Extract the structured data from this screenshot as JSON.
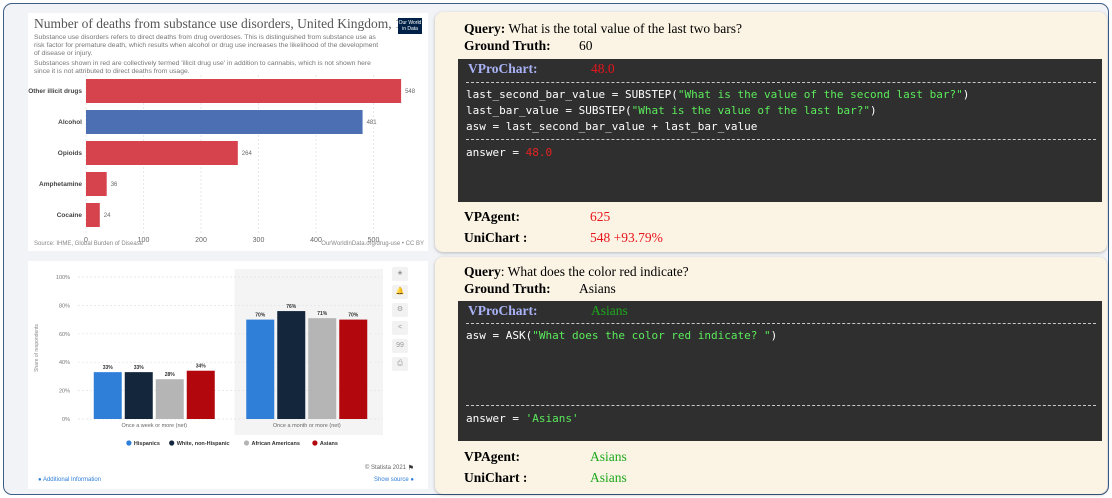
{
  "top_chart": {
    "title": "Number of deaths from substance use disorders, United Kingdom, 1990",
    "subtitle1": "Substance use disorders refers to direct deaths from drug overdoses. This is distinguished from substance use as risk factor for premature death, which results when alcohol or drug use increases the likelihood of the development of disease or injury.",
    "subtitle2": "Substances shown in red are collectively termed 'illicit drug use' in addition to cannabis, which is not shown here since it is not attributed to direct deaths from usage.",
    "logo_text": "Our World in Data",
    "source": "Source: IHME, Global Burden of Disease",
    "license": "OurWorldInData.org/drug-use • CC BY",
    "chart_data": {
      "type": "bar",
      "orientation": "horizontal",
      "categories": [
        "Other illicit drugs",
        "Alcohol",
        "Opioids",
        "Amphetamine",
        "Cocaine"
      ],
      "values": [
        548,
        481,
        264,
        36,
        24
      ],
      "colors": [
        "#d6434d",
        "#4c6fb3",
        "#d6434d",
        "#d6434d",
        "#d6434d"
      ],
      "xticks": [
        0,
        100,
        200,
        300,
        400,
        500
      ],
      "xlim": [
        0,
        560
      ],
      "grid": true
    }
  },
  "bottom_chart": {
    "side_icons": [
      "star-icon",
      "bell-icon",
      "gear-icon",
      "share-icon",
      "quote-icon",
      "print-icon"
    ],
    "side_glyphs": [
      "★",
      "🔔",
      "⚙",
      "<",
      "99",
      "⎙"
    ],
    "copyright": "© Statista 2021",
    "additional_info": "Additional Information",
    "show_source": "Show source",
    "chart_data": {
      "type": "bar",
      "categories": [
        "Once a week or more (net)",
        "Once a month or more (net)"
      ],
      "series": [
        {
          "name": "Hispanics",
          "values": [
            33,
            70
          ],
          "color": "#2f7ed8"
        },
        {
          "name": "White, non-Hispanic",
          "values": [
            33,
            76
          ],
          "color": "#13263b"
        },
        {
          "name": "African Americans",
          "values": [
            28,
            71
          ],
          "color": "#b5b5b5"
        },
        {
          "name": "Asians",
          "values": [
            34,
            70
          ],
          "color": "#b2070d"
        }
      ],
      "value_labels": [
        [
          "33%",
          "33%",
          "28%",
          "34%"
        ],
        [
          "70%",
          "76%",
          "71%",
          "70%"
        ]
      ],
      "yticks": [
        "0%",
        "20%",
        "40%",
        "60%",
        "80%",
        "100%"
      ],
      "ylabel": "Share of respondents",
      "ylim": [
        0,
        100
      ],
      "grid": true,
      "legend": "bottom"
    }
  },
  "card1": {
    "query_label": "Query:",
    "query_text": " What is the total value of the last two bars?",
    "gt_label": "Ground Truth:",
    "gt_value": "60",
    "vpro_label": "VProChart:",
    "vpro_value": "48.0",
    "code_l1_a": "last_second_bar_value = SUBSTEP(",
    "code_l1_b": "\"What is the value of the second last bar?\"",
    "code_l1_c": ")",
    "code_l2_a": "last_bar_value = SUBSTEP(",
    "code_l2_b": "\"What is the value of the last bar?\"",
    "code_l2_c": ")",
    "code_l3": "asw = last_second_bar_value + last_bar_value",
    "code_ans_a": "answer = ",
    "code_ans_b": "48.0",
    "vpagent_label": "VPAgent:",
    "vpagent_value": "625",
    "unichart_label": "UniChart :",
    "unichart_value": "548  +93.79%"
  },
  "card2": {
    "query_label": "Query",
    "query_text": ": What does the color red indicate?",
    "gt_label": "Ground Truth:",
    "gt_value": "Asians",
    "vpro_label": "VProChart:",
    "vpro_value": "Asians",
    "code_l1_a": "asw = ASK(",
    "code_l1_b": "\"What does the color red indicate? \"",
    "code_l1_c": ")",
    "code_ans_a": "answer = ",
    "code_ans_b": "'Asians'",
    "vpagent_label": "VPAgent:",
    "vpagent_value": "Asians",
    "unichart_label": "UniChart :",
    "unichart_value": "Asians"
  }
}
